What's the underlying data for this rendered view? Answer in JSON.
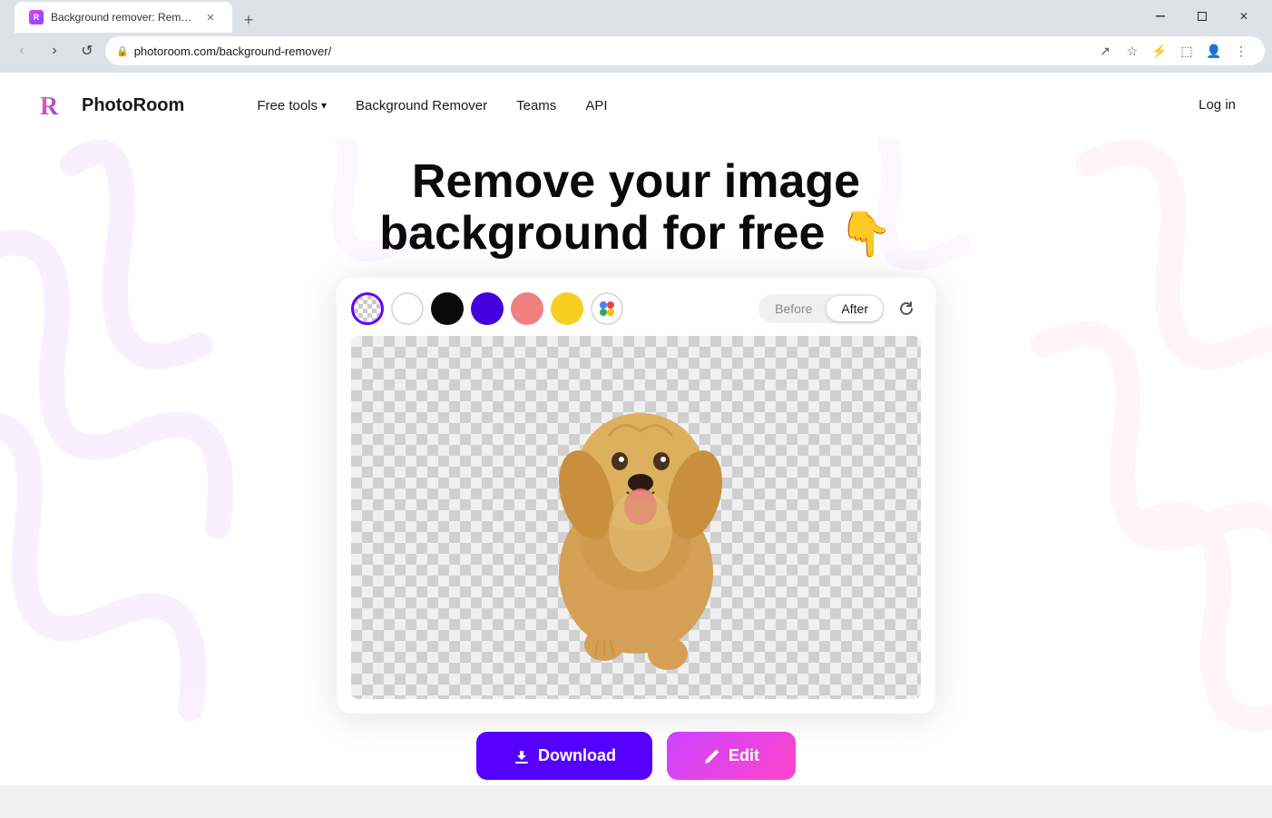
{
  "browser": {
    "tab_title": "Background remover: Remove yo",
    "tab_favicon": "R",
    "url": "photoroom.com/background-remover/",
    "nav_back": "‹",
    "nav_forward": "›",
    "nav_refresh": "↺",
    "new_tab_icon": "+",
    "window_controls": {
      "minimize": "—",
      "maximize": "□",
      "close": "✕"
    }
  },
  "nav": {
    "logo_text": "PhotoRoom",
    "links": [
      {
        "label": "Free tools",
        "has_dropdown": true
      },
      {
        "label": "Background Remover"
      },
      {
        "label": "Teams"
      },
      {
        "label": "API"
      }
    ],
    "login_label": "Log in"
  },
  "hero": {
    "title_line1": "Remove your image",
    "title_line2": "background for free",
    "hand_emoji": "👇"
  },
  "editor": {
    "swatches": [
      {
        "type": "transparent",
        "label": "Transparent"
      },
      {
        "type": "white",
        "label": "White"
      },
      {
        "type": "black",
        "label": "Black"
      },
      {
        "type": "purple",
        "label": "Purple"
      },
      {
        "type": "pink",
        "label": "Pink"
      },
      {
        "type": "yellow",
        "label": "Yellow"
      },
      {
        "type": "multicolor",
        "label": "More colors"
      }
    ],
    "before_label": "Before",
    "after_label": "After",
    "refresh_icon": "↺",
    "download_label": "Download",
    "edit_label": "Edit",
    "download_icon": "⬇",
    "edit_icon": "✏"
  }
}
